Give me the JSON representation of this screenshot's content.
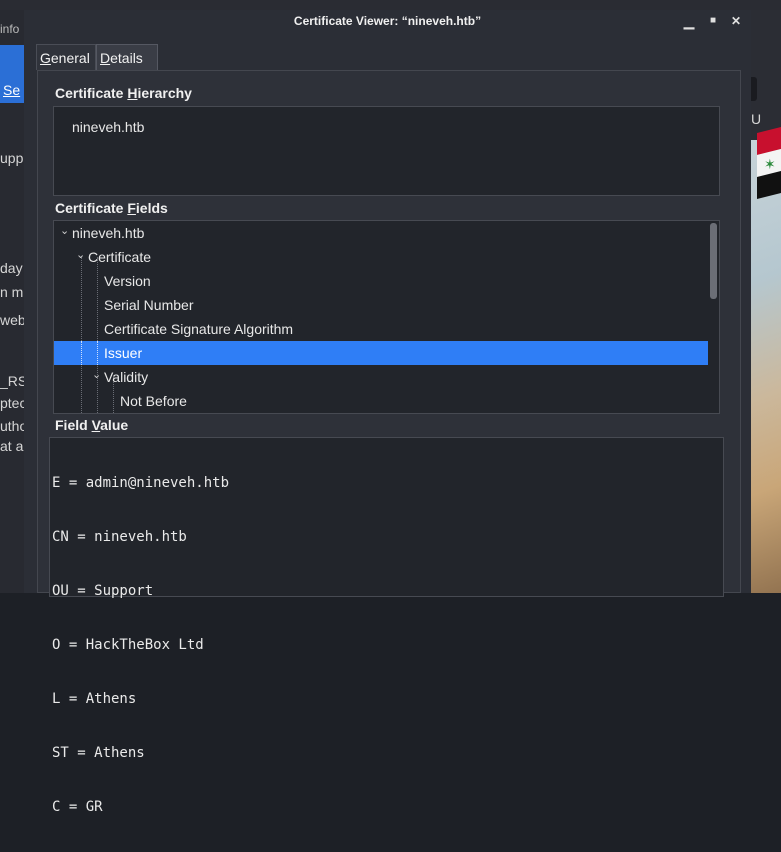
{
  "background": {
    "top_fragment": "info",
    "tab_fragment": "Se",
    "left_fragments": [
      "upp",
      "day",
      "n m",
      "web",
      "_RS",
      "ptec",
      "utho",
      "at a"
    ],
    "right_fragment": "U"
  },
  "window": {
    "title": "Certificate Viewer: “nineveh.htb”",
    "minimize_glyph": "▁",
    "maximize_glyph": "■",
    "close_glyph": "✕"
  },
  "tabs": [
    {
      "label_pre": "",
      "label_ul": "G",
      "label_post": "eneral",
      "active": false
    },
    {
      "label_pre": "",
      "label_ul": "D",
      "label_post": "etails",
      "active": true
    }
  ],
  "hierarchy": {
    "title_pre": "Certificate ",
    "title_ul": "H",
    "title_post": "ierarchy",
    "items": [
      "nineveh.htb"
    ]
  },
  "fields": {
    "title_pre": "Certificate ",
    "title_ul": "F",
    "title_post": "ields",
    "rows": [
      {
        "label": "nineveh.htb",
        "twist": "⌄",
        "selected": false
      },
      {
        "label": "Certificate",
        "twist": "⌄",
        "selected": false
      },
      {
        "label": "Version",
        "twist": "",
        "selected": false
      },
      {
        "label": "Serial Number",
        "twist": "",
        "selected": false
      },
      {
        "label": "Certificate Signature Algorithm",
        "twist": "",
        "selected": false
      },
      {
        "label": "Issuer",
        "twist": "",
        "selected": true
      },
      {
        "label": "Validity",
        "twist": "⌄",
        "selected": false
      },
      {
        "label": "Not Before",
        "twist": "",
        "selected": false
      }
    ]
  },
  "field_value": {
    "title_pre": "Field ",
    "title_ul": "V",
    "title_post": "alue",
    "lines": [
      "E = admin@nineveh.htb",
      "CN = nineveh.htb",
      "OU = Support",
      "O = HackTheBox Ltd",
      "L = Athens",
      "ST = Athens",
      "C = GR"
    ]
  },
  "colors": {
    "selection": "#2f7ef6",
    "dialog_bg": "#2b2e36",
    "box_bg": "#22252b"
  }
}
